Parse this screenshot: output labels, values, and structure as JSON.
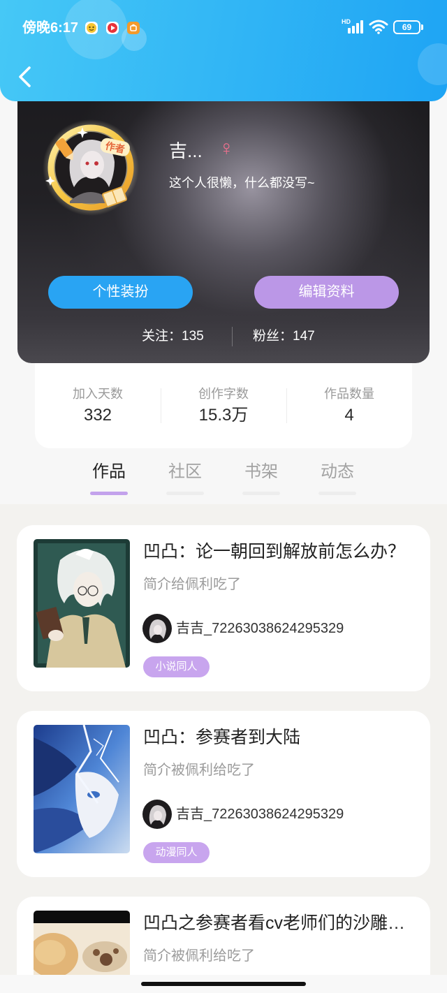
{
  "status_bar": {
    "time": "傍晚6:17",
    "notification_icons": [
      "chat-app-icon",
      "video-app-icon",
      "store-app-icon"
    ],
    "network_label": "HD",
    "signal_icon": "signal-bars-icon",
    "wifi_icon": "wifi-icon",
    "battery_level": "69"
  },
  "header": {
    "back_icon": "chevron-left-icon"
  },
  "profile": {
    "avatar_frame_badge": "作者",
    "name": "吉...",
    "gender_symbol": "♀",
    "bio": "这个人很懒，什么都没写~",
    "buttons": {
      "dress_up": "个性装扮",
      "edit_profile": "编辑资料"
    },
    "following": {
      "label": "关注：",
      "count": "135"
    },
    "followers": {
      "label": "粉丝：",
      "count": "147"
    }
  },
  "stats": [
    {
      "label": "加入天数",
      "value": "332"
    },
    {
      "label": "创作字数",
      "value": "15.3万"
    },
    {
      "label": "作品数量",
      "value": "4"
    }
  ],
  "tabs": [
    {
      "label": "作品",
      "active": true
    },
    {
      "label": "社区",
      "active": false
    },
    {
      "label": "书架",
      "active": false
    },
    {
      "label": "动态",
      "active": false
    }
  ],
  "works": [
    {
      "title": "凹凸：论一朝回到解放前怎么办？",
      "description": "简介给佩利吃了",
      "author": "吉吉_72263038624295329",
      "tag": "小说同人"
    },
    {
      "title": "凹凸：参赛者到大陆",
      "description": "简介被佩利给吃了",
      "author": "吉吉_72263038624295329",
      "tag": "动漫同人"
    },
    {
      "title": "凹凸之参赛者看cv老师们的沙雕…",
      "description": "简介被佩利给吃了"
    }
  ],
  "colors": {
    "header_gradient_start": "#46c8f6",
    "header_gradient_end": "#1ea4f4",
    "dress_up_button": "#29a4f3",
    "edit_profile_button": "#bb97e7",
    "gender_symbol": "#f0708e",
    "active_tab_indicator": "#c3a2ec",
    "tag_background": "#c8a5ee"
  }
}
